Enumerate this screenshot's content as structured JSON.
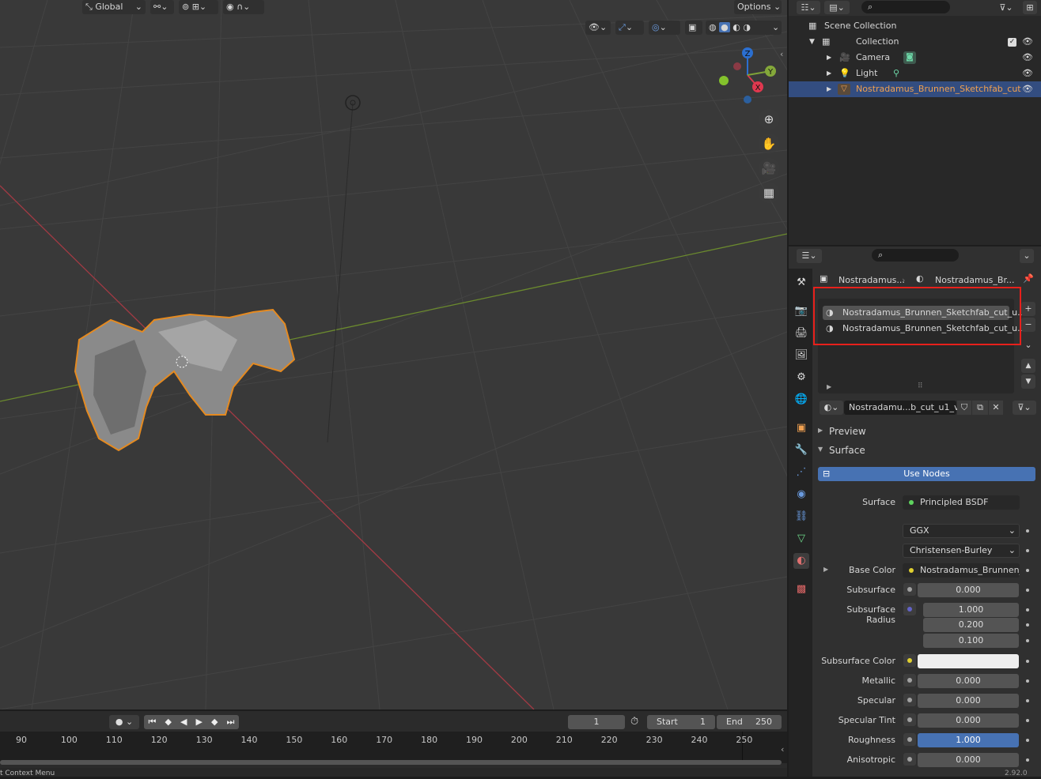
{
  "viewport_header": {
    "transform_orientation": "Global",
    "options_label": "Options"
  },
  "timeline": {
    "current_frame": "1",
    "start_label": "Start",
    "start_value": "1",
    "end_label": "End",
    "end_value": "250",
    "ruler": [
      "90",
      "100",
      "110",
      "120",
      "130",
      "140",
      "150",
      "160",
      "170",
      "180",
      "190",
      "200",
      "210",
      "220",
      "230",
      "240",
      "250"
    ],
    "status_left": "t Context Menu",
    "status_right": "2.92.0"
  },
  "outliner": {
    "scene_collection": "Scene Collection",
    "collection": "Collection",
    "items": [
      {
        "label": "Camera"
      },
      {
        "label": "Light"
      },
      {
        "label": "Nostradamus_Brunnen_Sketchfab_cut"
      }
    ]
  },
  "properties": {
    "breadcrumb_object": "Nostradamus...",
    "breadcrumb_material": "Nostradamus_Br...",
    "material_slots": [
      "Nostradamus_Brunnen_Sketchfab_cut_u...",
      "Nostradamus_Brunnen_Sketchfab_cut_u..."
    ],
    "material_name": "Nostradamu...b_cut_u1_v1",
    "panels": {
      "preview": "Preview",
      "surface": "Surface"
    },
    "use_nodes": "Use Nodes",
    "surface_label": "Surface",
    "surface_value": "Principled BSDF",
    "distribution": "GGX",
    "subsurface_method": "Christensen-Burley",
    "params": [
      {
        "label": "Base Color",
        "value": "Nostradamus_Brunnen_..."
      },
      {
        "label": "Subsurface",
        "value": "0.000"
      },
      {
        "label": "Subsurface Radius",
        "values": [
          "1.000",
          "0.200",
          "0.100"
        ]
      },
      {
        "label": "Subsurface Color",
        "value": ""
      },
      {
        "label": "Metallic",
        "value": "0.000"
      },
      {
        "label": "Specular",
        "value": "0.000"
      },
      {
        "label": "Specular Tint",
        "value": "0.000"
      },
      {
        "label": "Roughness",
        "value": "1.000"
      },
      {
        "label": "Anisotropic",
        "value": "0.000"
      }
    ]
  },
  "colors": {
    "selection_outline": "#e58a20",
    "highlight_box": "#e8201b",
    "active_row": "#334d80",
    "accent_blue": "#4772b3"
  }
}
